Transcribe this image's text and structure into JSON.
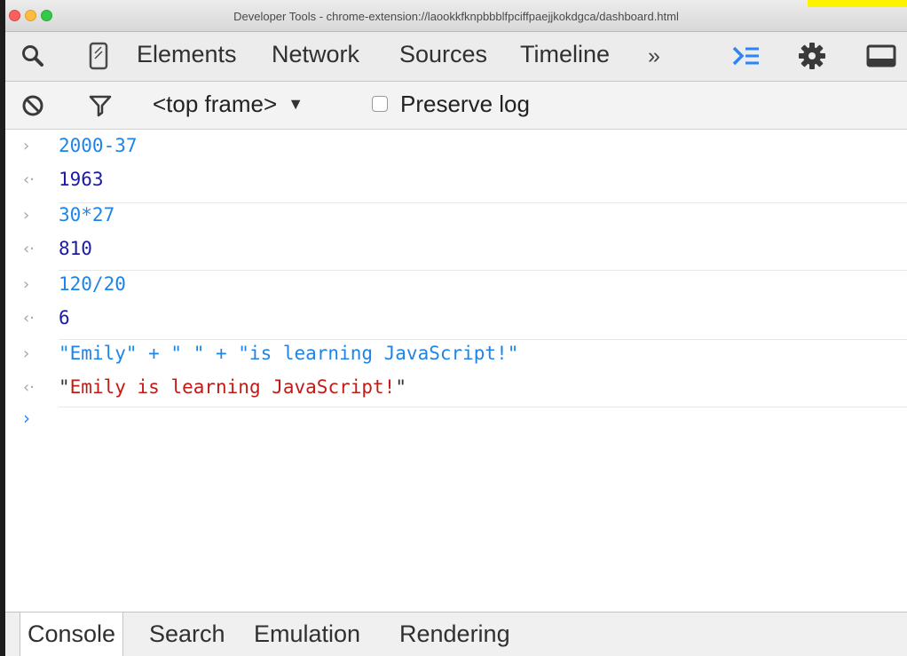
{
  "window": {
    "title": "Developer Tools - chrome-extension://laookkfknpbbblfpciffpaejjkokdgca/dashboard.html"
  },
  "toolbar": {
    "tabs": [
      "Elements",
      "Network",
      "Sources",
      "Timeline"
    ],
    "more_label": "»",
    "icons": [
      "search-icon",
      "device-mode-icon",
      "console-drawer-icon",
      "settings-gear-icon",
      "dock-icon"
    ]
  },
  "console_toolbar": {
    "frame_select": "<top frame>",
    "frame_arrow": "▼",
    "preserve_log_label": "Preserve log",
    "preserve_log_checked": false
  },
  "console": {
    "entries": [
      {
        "type": "input",
        "gutter": "›",
        "text": "2000-37"
      },
      {
        "type": "result",
        "gutter": "‹·",
        "text": "1963"
      },
      {
        "type": "input",
        "gutter": "›",
        "text": "30*27"
      },
      {
        "type": "result",
        "gutter": "‹·",
        "text": "810"
      },
      {
        "type": "input",
        "gutter": "›",
        "text": "120/20"
      },
      {
        "type": "result",
        "gutter": "‹·",
        "text": "6"
      },
      {
        "type": "input",
        "gutter": "›",
        "text": "\"Emily\" + \" \" + \"is learning JavaScript!\""
      },
      {
        "type": "result-string",
        "gutter": "‹·",
        "quote": "\"",
        "text": "Emily is learning JavaScript!"
      }
    ],
    "prompt": "›"
  },
  "drawer": {
    "tabs": [
      "Console",
      "Search",
      "Emulation",
      "Rendering"
    ],
    "active": "Console"
  },
  "colors": {
    "command": "#1f84e8",
    "number_result": "#1a1aa6",
    "string_result": "#c41a16",
    "accent": "#2d84f6"
  }
}
